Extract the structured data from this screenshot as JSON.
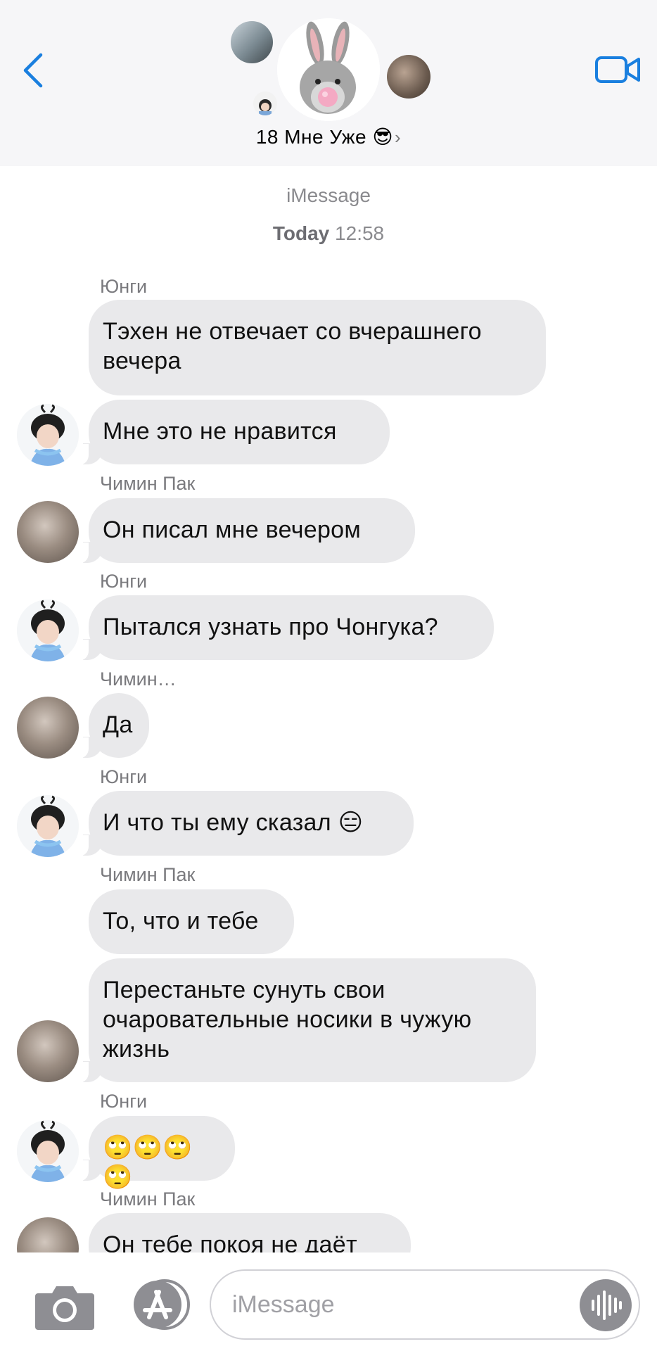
{
  "header": {
    "group_name": "18 Мне Уже 😎",
    "chevron": "›",
    "back_icon": "chevron-left-icon",
    "video_icon": "video-camera-icon",
    "accent_color": "#1a7fdf"
  },
  "meta": {
    "service": "iMessage",
    "day": "Today",
    "time": "12:58"
  },
  "messages": [
    {
      "sender": "Юнги",
      "lines": [
        "Тэхен не отвечает со вчерашнего",
        "вечера"
      ]
    },
    {
      "sender": "",
      "lines": [
        "Мне это не нравится"
      ],
      "avatar": "yoongi"
    },
    {
      "sender": "Чимин Пак",
      "lines": [
        "Он писал мне вечером"
      ],
      "avatar": "jimin"
    },
    {
      "sender": "Юнги",
      "lines": [
        "Пытался узнать про Чонгука?"
      ],
      "avatar": "yoongi"
    },
    {
      "sender": "Чимин…",
      "lines": [
        "Да"
      ],
      "avatar": "jimin"
    },
    {
      "sender": "Юнги",
      "lines": [
        "И что ты ему сказал 😑"
      ],
      "avatar": "yoongi"
    },
    {
      "sender": "Чимин Пак",
      "lines": [
        "То, что и тебе"
      ]
    },
    {
      "sender": "",
      "lines": [
        "Перестаньте сунуть свои",
        "очаровательные носики в чужую",
        "жизнь"
      ],
      "avatar": "jimin"
    },
    {
      "sender": "Юнги",
      "lines": [
        "🙄🙄🙄🙄"
      ],
      "avatar": "yoongi"
    },
    {
      "sender": "Чимин Пак",
      "lines": [
        "Он тебе покоя не даёт"
      ],
      "avatar": "jimin"
    }
  ],
  "composer": {
    "placeholder": "iMessage",
    "camera_icon": "camera-icon",
    "apps_icon": "app-store-icon",
    "audio_icon": "audio-waveform-icon"
  }
}
